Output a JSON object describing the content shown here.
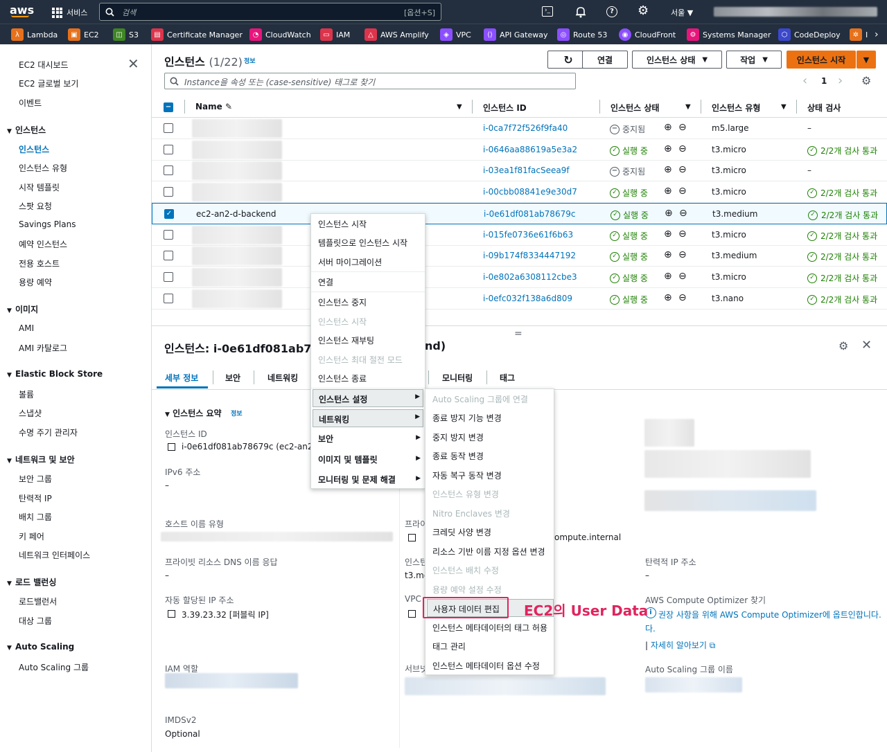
{
  "topnav": {
    "logo": "aws",
    "services_label": "서비스",
    "search_placeholder": "검색",
    "search_shortcut": "[옵션+S]",
    "region": "서울 ▼"
  },
  "favorites": [
    "Lambda",
    "EC2",
    "S3",
    "Certificate Manager",
    "CloudWatch",
    "IAM",
    "AWS Amplify",
    "VPC",
    "API Gateway",
    "Route 53",
    "CloudFront",
    "Systems Manager",
    "CodeDeploy",
    "I"
  ],
  "sidebar": {
    "top_items": [
      "EC2 대시보드",
      "EC2 글로벌 보기",
      "이벤트"
    ],
    "sections": [
      {
        "title": "인스턴스",
        "items": [
          "인스턴스",
          "인스턴스 유형",
          "시작 템플릿",
          "스팟 요청",
          "Savings Plans",
          "예약 인스턴스",
          "전용 호스트",
          "용량 예약"
        ]
      },
      {
        "title": "이미지",
        "items": [
          "AMI",
          "AMI 카탈로그"
        ]
      },
      {
        "title": "Elastic Block Store",
        "items": [
          "볼륨",
          "스냅샷",
          "수명 주기 관리자"
        ]
      },
      {
        "title": "네트워크 및 보안",
        "items": [
          "보안 그룹",
          "탄력적 IP",
          "배치 그룹",
          "키 페어",
          "네트워크 인터페이스"
        ]
      },
      {
        "title": "로드 밸런싱",
        "items": [
          "로드밸런서",
          "대상 그룹"
        ]
      },
      {
        "title": "Auto Scaling",
        "items": [
          "Auto Scaling 그룹"
        ]
      }
    ]
  },
  "header": {
    "title": "인스턴스",
    "count": "(1/22)",
    "info": "정보",
    "btn_connect": "연결",
    "btn_state": "인스턴스 상태",
    "btn_actions": "작업",
    "btn_launch": "인스턴스 시작",
    "filter_placeholder": "Instance을 속성 또는 (case-sensitive) 태그로 찾기",
    "page": "1"
  },
  "table": {
    "columns": [
      "Name",
      "인스턴스 ID",
      "인스턴스 상태",
      "인스턴스 유형",
      "상태 검사"
    ],
    "rows": [
      {
        "name": "",
        "id": "i-0ca7f72f526f9fa40",
        "state": "중지됨",
        "type": "m5.large",
        "check": "–",
        "running": false,
        "selected": false
      },
      {
        "name": "",
        "id": "i-0646aa88619a5e3a2",
        "state": "실행 중",
        "type": "t3.micro",
        "check": "2/2개 검사 통과",
        "running": true,
        "selected": false
      },
      {
        "name": "",
        "id": "i-03ea1f81facSeea9f",
        "state": "중지됨",
        "type": "t3.micro",
        "check": "–",
        "running": false,
        "selected": false
      },
      {
        "name": "",
        "id": "i-00cbb08841e9e30d7",
        "state": "실행 중",
        "type": "t3.micro",
        "check": "2/2개 검사 통과",
        "running": true,
        "selected": false
      },
      {
        "name": "ec2-an2-d-backend",
        "id": "i-0e61df081ab78679c",
        "state": "실행 중",
        "type": "t3.medium",
        "check": "2/2개 검사 통과",
        "running": true,
        "selected": true
      },
      {
        "name": "",
        "id": "i-015fe0736e61f6b63",
        "state": "실행 중",
        "type": "t3.micro",
        "check": "2/2개 검사 통과",
        "running": true,
        "selected": false
      },
      {
        "name": "",
        "id": "i-09b174f8334447192",
        "state": "실행 중",
        "type": "t3.medium",
        "check": "2/2개 검사 통과",
        "running": true,
        "selected": false
      },
      {
        "name": "",
        "id": "i-0e802a6308112cbe3",
        "state": "실행 중",
        "type": "t3.micro",
        "check": "2/2개 검사 통과",
        "running": true,
        "selected": false
      },
      {
        "name": "",
        "id": "i-0efc032f138a6d809",
        "state": "실행 중",
        "type": "t3.nano",
        "check": "2/2개 검사 통과",
        "running": true,
        "selected": false
      }
    ]
  },
  "detail": {
    "title": "인스턴스: i-0e61df081ab786",
    "title_suffix": "nd)",
    "tabs": [
      "세부 정보",
      "보안",
      "네트워킹",
      "모니터링",
      "태그"
    ],
    "summary_title": "인스턴스 요약",
    "summary_info": "정보",
    "instance_id_label": "인스턴스 ID",
    "instance_id_value": "i-0e61df081ab78679c (ec2-an2",
    "ipv6_label": "IPv6 주소",
    "ipv6_value": "–",
    "hostname_type_label": "호스트 이름 유형",
    "private_dns_label": "프라이빗 리소스 DNS 이름 응답",
    "private_dns_value": "–",
    "auto_ip_label": "자동 할당된 IP 주소",
    "auto_ip_value": "3.39.23.32 [퍼블릭 IP]",
    "iam_label": "IAM 역할",
    "imds_label": "IMDSv2",
    "imds_value": "Optional",
    "mid_private_label": "프라이",
    "mid_internal": "ompute.internal",
    "mid_type_label": "인스턴",
    "mid_type_value": "t3.mc",
    "mid_vpc_label": "VPC",
    "mid_subnet_label": "서브넷",
    "eip_label": "탄력적 IP 주소",
    "eip_value": "–",
    "optimizer_label": "AWS Compute Optimizer 찾기",
    "optimizer_text": "권장 사항을 위해 AWS Compute Optimizer에 옵트인합니다.",
    "optimizer_text2": "다.",
    "learn_more": "자세히 알아보기",
    "asg_label": "Auto Scaling 그룹 이름"
  },
  "context_menu": {
    "items": [
      {
        "label": "인스턴스 시작",
        "disabled": false
      },
      {
        "label": "템플릿으로 인스턴스 시작",
        "disabled": false
      },
      {
        "label": "서버 마이그레이션",
        "disabled": false
      },
      {
        "label": "연결",
        "disabled": false
      },
      {
        "label": "인스턴스 중지",
        "disabled": false
      },
      {
        "label": "인스턴스 시작",
        "disabled": true
      },
      {
        "label": "인스턴스 재부팅",
        "disabled": false
      },
      {
        "label": "인스턴스 최대 절전 모드",
        "disabled": true
      },
      {
        "label": "인스턴스 종료",
        "disabled": false
      }
    ],
    "submenus": [
      "인스턴스 설정",
      "네트워킹",
      "보안",
      "이미지 및 템플릿",
      "모니터링 및 문제 해결"
    ]
  },
  "settings_submenu": {
    "items": [
      {
        "label": "Auto Scaling 그룹에 연결",
        "disabled": true
      },
      {
        "label": "종료 방지 기능 변경",
        "disabled": false
      },
      {
        "label": "중지 방지 변경",
        "disabled": false
      },
      {
        "label": "종료 동작 변경",
        "disabled": false
      },
      {
        "label": "자동 복구 동작 변경",
        "disabled": false
      },
      {
        "label": "인스턴스 유형 변경",
        "disabled": true
      },
      {
        "label": "Nitro Enclaves 변경",
        "disabled": true
      },
      {
        "label": "크레딧 사양 변경",
        "disabled": false
      },
      {
        "label": "리소스 기반 이름 지정 옵션 변경",
        "disabled": false
      },
      {
        "label": "인스턴스 배치 수정",
        "disabled": true
      },
      {
        "label": "용량 예약 설정 수정",
        "disabled": true
      },
      {
        "label": "사용자 데이터 편집",
        "disabled": false
      },
      {
        "label": "인스턴스 메타데이터의 태그 허용",
        "disabled": false
      },
      {
        "label": "태그 관리",
        "disabled": false
      },
      {
        "label": "인스턴스 메타데이터 옵션 수정",
        "disabled": false
      }
    ]
  },
  "annotation": "EC2의 User Data",
  "colors": {
    "nav": "#232f3e",
    "accent": "#ec7211",
    "link": "#0073bb",
    "ok": "#1d8102",
    "highlight": "#e0245e"
  }
}
